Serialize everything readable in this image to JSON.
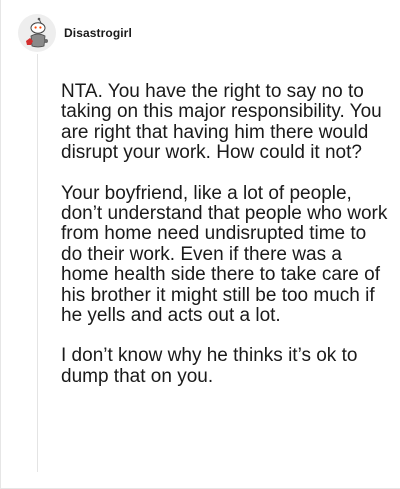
{
  "comment": {
    "username": "Disastrogirl",
    "avatar_icon": "snoo-avatar-icon",
    "paragraphs": [
      "NTA. You have the right to say no to taking on this major responsibility. You are right that having him there would disrupt your work. How could it not?",
      "Your boyfriend, like a lot of people, don’t understand that people who work from home need undisrupted time to do their work. Even if there was a home health side there to take care of his brother it might still be too much if he yells and acts out a lot.",
      "I don’t know why he thinks it’s ok to dump that on you."
    ]
  }
}
